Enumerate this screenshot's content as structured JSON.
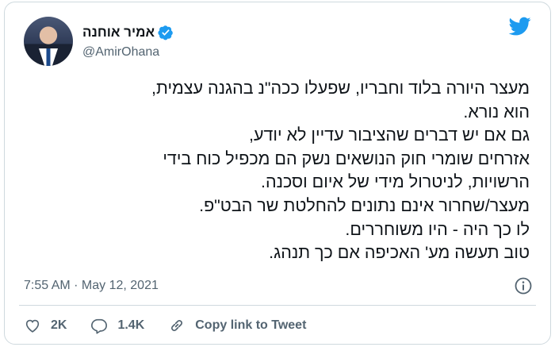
{
  "author": {
    "display_name": "אמיר אוחנה",
    "handle": "@AmirOhana",
    "verified": true
  },
  "tweet": {
    "lines": [
      "מעצר היורה בלוד וחבריו, שפעלו ככה\"נ בהגנה עצמית,",
      "הוא נורא.",
      "גם אם יש דברים שהציבור עדיין לא יודע,",
      "אזרחים שומרי חוק הנושאים נשק הם מכפיל כוח בידי",
      "הרשויות, לניטרול מידי של איום וסכנה.",
      "מעצר/שחרור אינם נתונים להחלטת שר הבט\"פ.",
      "לו כך היה - היו משוחררים.",
      "טוב תעשה מע' האכיפה אם כך תנהג."
    ],
    "timestamp": "7:55 AM · May 12, 2021"
  },
  "actions": {
    "likes": "2K",
    "replies": "1.4K",
    "copy_link": "Copy link to Tweet"
  },
  "colors": {
    "twitter_blue": "#1d9bf0",
    "text_primary": "#0f1419",
    "text_secondary": "#536471",
    "border": "#cfd9de"
  },
  "icons": [
    "twitter-logo-icon",
    "verified-badge-icon",
    "info-icon",
    "heart-icon",
    "reply-icon",
    "link-icon"
  ]
}
